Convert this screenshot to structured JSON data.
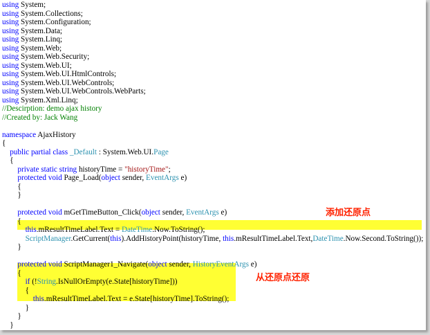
{
  "colors": {
    "keyword": "#0000ff",
    "type": "#2b91af",
    "string": "#a31515",
    "comment": "#008000",
    "highlight": "#ffff33",
    "annotation": "#ff2200"
  },
  "annotations": {
    "add_restore_point": "添加还原点",
    "restore_from_point": "从还原点还原"
  },
  "lines": [
    [
      {
        "t": "using",
        "c": "kw"
      },
      {
        "t": " System;"
      }
    ],
    [
      {
        "t": "using",
        "c": "kw"
      },
      {
        "t": " System.Collections;"
      }
    ],
    [
      {
        "t": "using",
        "c": "kw"
      },
      {
        "t": " System.Configuration;"
      }
    ],
    [
      {
        "t": "using",
        "c": "kw"
      },
      {
        "t": " System.Data;"
      }
    ],
    [
      {
        "t": "using",
        "c": "kw"
      },
      {
        "t": " System.Linq;"
      }
    ],
    [
      {
        "t": "using",
        "c": "kw"
      },
      {
        "t": " System.Web;"
      }
    ],
    [
      {
        "t": "using",
        "c": "kw"
      },
      {
        "t": " System.Web.Security;"
      }
    ],
    [
      {
        "t": "using",
        "c": "kw"
      },
      {
        "t": " System.Web.UI;"
      }
    ],
    [
      {
        "t": "using",
        "c": "kw"
      },
      {
        "t": " System.Web.UI.HtmlControls;"
      }
    ],
    [
      {
        "t": "using",
        "c": "kw"
      },
      {
        "t": " System.Web.UI.WebControls;"
      }
    ],
    [
      {
        "t": "using",
        "c": "kw"
      },
      {
        "t": " System.Web.UI.WebControls.WebParts;"
      }
    ],
    [
      {
        "t": "using",
        "c": "kw"
      },
      {
        "t": " System.Xml.Linq;"
      }
    ],
    [
      {
        "t": "//Descirption: demo ajax history",
        "c": "cm"
      }
    ],
    [
      {
        "t": "//Created by: Jack Wang",
        "c": "cm"
      }
    ],
    [],
    [
      {
        "t": "namespace",
        "c": "kw"
      },
      {
        "t": " AjaxHistory"
      }
    ],
    [
      {
        "t": "{"
      }
    ],
    [
      {
        "t": "    "
      },
      {
        "t": "public",
        "c": "kw"
      },
      {
        "t": " "
      },
      {
        "t": "partial",
        "c": "kw"
      },
      {
        "t": " "
      },
      {
        "t": "class",
        "c": "kw"
      },
      {
        "t": " "
      },
      {
        "t": "_Default",
        "c": "ty"
      },
      {
        "t": " : System.Web.UI."
      },
      {
        "t": "Page",
        "c": "ty"
      }
    ],
    [
      {
        "t": "    {"
      }
    ],
    [
      {
        "t": "        "
      },
      {
        "t": "private",
        "c": "kw"
      },
      {
        "t": " "
      },
      {
        "t": "static",
        "c": "kw"
      },
      {
        "t": " "
      },
      {
        "t": "string",
        "c": "kw"
      },
      {
        "t": " historyTime = "
      },
      {
        "t": "\"historyTime\"",
        "c": "str"
      },
      {
        "t": ";"
      }
    ],
    [
      {
        "t": "        "
      },
      {
        "t": "protected",
        "c": "kw"
      },
      {
        "t": " "
      },
      {
        "t": "void",
        "c": "kw"
      },
      {
        "t": " Page_Load("
      },
      {
        "t": "object",
        "c": "kw"
      },
      {
        "t": " sender, "
      },
      {
        "t": "EventArgs",
        "c": "ty"
      },
      {
        "t": " e)"
      }
    ],
    [
      {
        "t": "        {"
      }
    ],
    [
      {
        "t": "        }"
      }
    ],
    [],
    [
      {
        "t": "        "
      },
      {
        "t": "protected",
        "c": "kw"
      },
      {
        "t": " "
      },
      {
        "t": "void",
        "c": "kw"
      },
      {
        "t": " mGetTimeButton_Click("
      },
      {
        "t": "object",
        "c": "kw"
      },
      {
        "t": " sender, "
      },
      {
        "t": "EventArgs",
        "c": "ty"
      },
      {
        "t": " e)"
      }
    ],
    [
      {
        "t": "        {"
      }
    ],
    [
      {
        "t": "            "
      },
      {
        "t": "this",
        "c": "kw"
      },
      {
        "t": ".mResultTimeLabel.Text = "
      },
      {
        "t": "DateTime",
        "c": "ty"
      },
      {
        "t": ".Now.ToString();"
      }
    ],
    [
      {
        "t": "            "
      },
      {
        "t": "ScriptManager",
        "c": "ty"
      },
      {
        "t": ".GetCurrent("
      },
      {
        "t": "this",
        "c": "kw"
      },
      {
        "t": ").AddHistoryPoint(historyTime, "
      },
      {
        "t": "this",
        "c": "kw"
      },
      {
        "t": ".mResultTimeLabel.Text,"
      },
      {
        "t": "DateTime",
        "c": "ty"
      },
      {
        "t": ".Now.Second.ToString());"
      }
    ],
    [
      {
        "t": "        }"
      }
    ],
    [],
    [
      {
        "t": "        "
      },
      {
        "t": "protected",
        "c": "kw"
      },
      {
        "t": " "
      },
      {
        "t": "void",
        "c": "kw"
      },
      {
        "t": " ScriptManager1_Navigate("
      },
      {
        "t": "object",
        "c": "kw"
      },
      {
        "t": " sender, "
      },
      {
        "t": "HistoryEventArgs",
        "c": "ty"
      },
      {
        "t": " e)"
      }
    ],
    [
      {
        "t": "        {"
      }
    ],
    [
      {
        "t": "            "
      },
      {
        "t": "if",
        "c": "kw"
      },
      {
        "t": " (!"
      },
      {
        "t": "String",
        "c": "ty"
      },
      {
        "t": ".IsNullOrEmpty(e.State[historyTime]))"
      }
    ],
    [
      {
        "t": "            {"
      }
    ],
    [
      {
        "t": "                "
      },
      {
        "t": "this",
        "c": "kw"
      },
      {
        "t": ".mResultTimeLabel.Text = e.State[historyTime].ToString();"
      }
    ],
    [
      {
        "t": "            }"
      }
    ],
    [
      {
        "t": "        }"
      }
    ],
    [
      {
        "t": "    }"
      }
    ],
    [
      {
        "t": "}"
      }
    ]
  ]
}
